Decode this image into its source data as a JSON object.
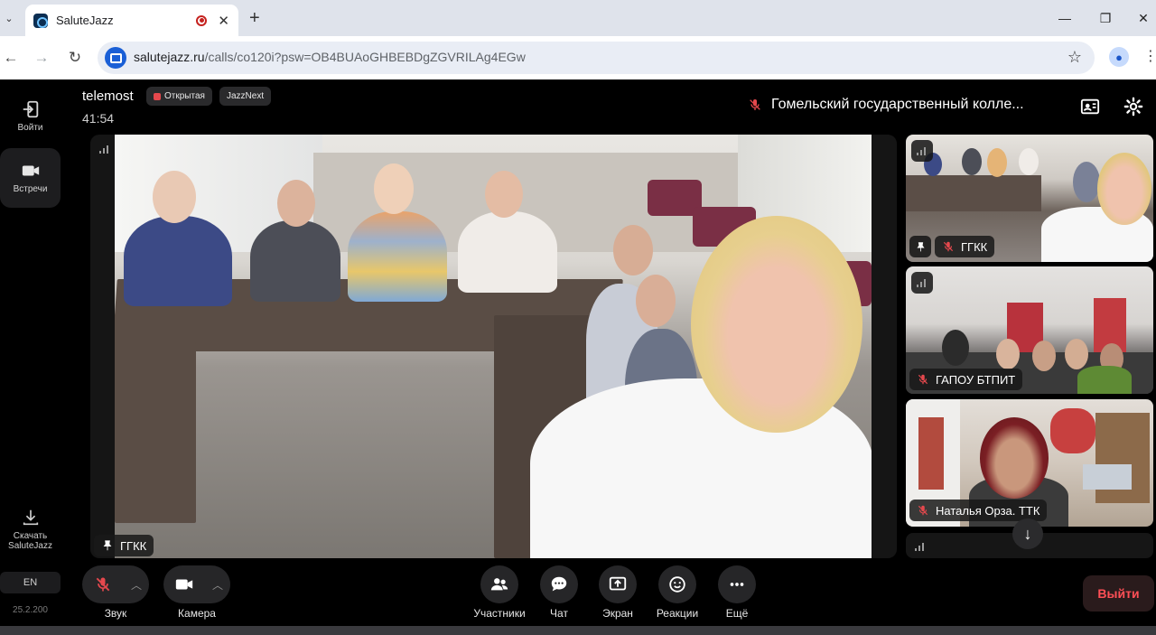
{
  "browser": {
    "tab_title": "SaluteJazz",
    "url_host": "salutejazz.ru",
    "url_path": "/calls/co120i?psw=OB4BUAoGHBEBDgZGVRILAg4EGw",
    "tab_list_glyph": "⌄",
    "new_tab_glyph": "+",
    "close_glyph": "✕",
    "minimize_glyph": "—",
    "restore_glyph": "❐",
    "window_close_glyph": "✕",
    "back_glyph": "←",
    "forward_glyph": "→",
    "reload_glyph": "↻",
    "star_glyph": "☆",
    "profile_glyph": "●",
    "menu_glyph": "⋮"
  },
  "sidebar": {
    "items": [
      {
        "label": "Войти",
        "icon": "login-icon"
      },
      {
        "label": "Встречи",
        "icon": "camera-icon"
      }
    ],
    "download_label_1": "Скачать",
    "download_label_2": "SaluteJazz",
    "language": "EN",
    "version": "25.2.200"
  },
  "header": {
    "meeting_name": "telemost",
    "chips": [
      "Открытая",
      "JazzNext"
    ],
    "timer": "41:54",
    "active_speaker": "Гомельский государственный колле..."
  },
  "main_video": {
    "participant": "ГГКК"
  },
  "tiles": [
    {
      "name": "ГГКК",
      "pinned": true,
      "muted": true
    },
    {
      "name": "ГАПОУ БТПИТ",
      "pinned": false,
      "muted": true
    },
    {
      "name": "Наталья Орза. ТТК",
      "pinned": false,
      "muted": true
    }
  ],
  "scroll_down_glyph": "↓",
  "controls": {
    "sound": "Звук",
    "camera": "Камера",
    "participants": "Участники",
    "chat": "Чат",
    "screen": "Экран",
    "reactions": "Реакции",
    "more": "Ещё",
    "caret_glyph": "︿",
    "leave": "Выйти"
  },
  "colors": {
    "leave_text": "#ff4f56",
    "mute_red": "#e5484d",
    "app_bg": "#000000"
  }
}
